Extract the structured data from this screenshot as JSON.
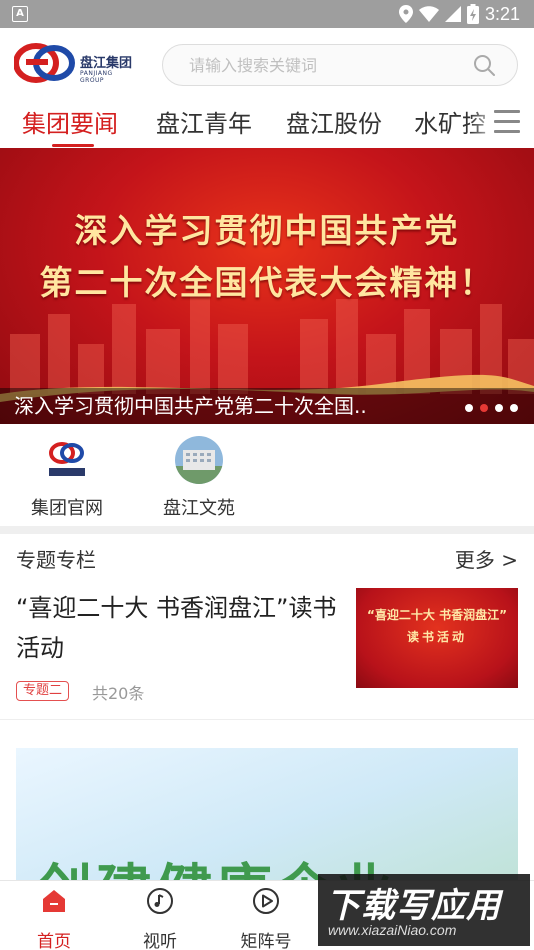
{
  "status_bar": {
    "notification_badge": "A",
    "time": "3:21"
  },
  "header": {
    "logo_text": "盘江集团",
    "logo_sub": "PANJIANG GROUP",
    "search_placeholder": "请输入搜索关键词"
  },
  "tabs": [
    {
      "label": "集团要闻",
      "active": true
    },
    {
      "label": "盘江青年",
      "active": false
    },
    {
      "label": "盘江股份",
      "active": false
    },
    {
      "label": "水矿控",
      "active": false
    }
  ],
  "banner": {
    "headline_line1": "深入学习贯彻中国共产党",
    "headline_line2": "第二十次全国代表大会精神！",
    "caption": "深入学习贯彻中国共产党第二十次全国..",
    "slide_count": 4,
    "active_slide": 2
  },
  "quick_links": [
    {
      "label": "集团官网",
      "icon": "group-logo-icon"
    },
    {
      "label": "盘江文苑",
      "icon": "building-photo-icon"
    }
  ],
  "special": {
    "title": "专题专栏",
    "more_label": "更多 >",
    "card": {
      "title": "“喜迎二十大 书香润盘江”读书活动",
      "tag": "专题二",
      "count": "共20条",
      "thumb_line1": "“喜迎二十大 书香润盘江”",
      "thumb_line2": "读书活动"
    }
  },
  "next_card": {
    "image_text": "创建健康企业"
  },
  "bottom_nav": [
    {
      "label": "首页",
      "icon": "home-icon",
      "active": true
    },
    {
      "label": "视听",
      "icon": "music-note-icon",
      "active": false
    },
    {
      "label": "矩阵号",
      "icon": "play-icon",
      "active": false
    }
  ],
  "watermark": {
    "title": "下载写应用",
    "url": "www.xiazaiNiao.com"
  },
  "colors": {
    "accent": "#d42020",
    "banner_red": "#c4141a",
    "gold_text": "#ffe6a0"
  }
}
